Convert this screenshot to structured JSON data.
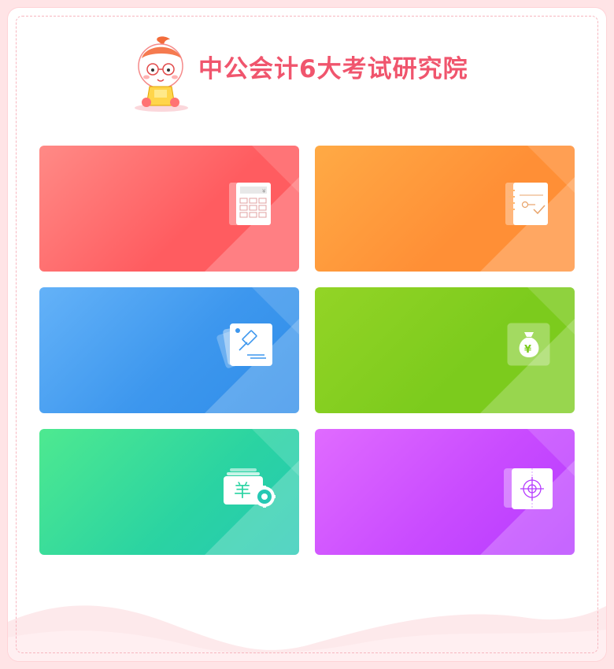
{
  "header": {
    "title": "中公会计6大考试研究院",
    "mascot_icon": "mascot-icon"
  },
  "cards": [
    {
      "icon": "calculator-icon",
      "accent": "#ff5c60"
    },
    {
      "icon": "notebook-check-icon",
      "accent": "#ff8f36"
    },
    {
      "icon": "gavel-icon",
      "accent": "#3d97ee"
    },
    {
      "icon": "money-bag-icon",
      "accent": "#7ccb1d"
    },
    {
      "icon": "yen-gear-icon",
      "accent": "#26c8b4"
    },
    {
      "icon": "target-icon",
      "accent": "#c94bff"
    }
  ],
  "colors": {
    "background": "#ffe4e6",
    "title": "#f0556d",
    "dashed_border": "#f7b6bf"
  }
}
